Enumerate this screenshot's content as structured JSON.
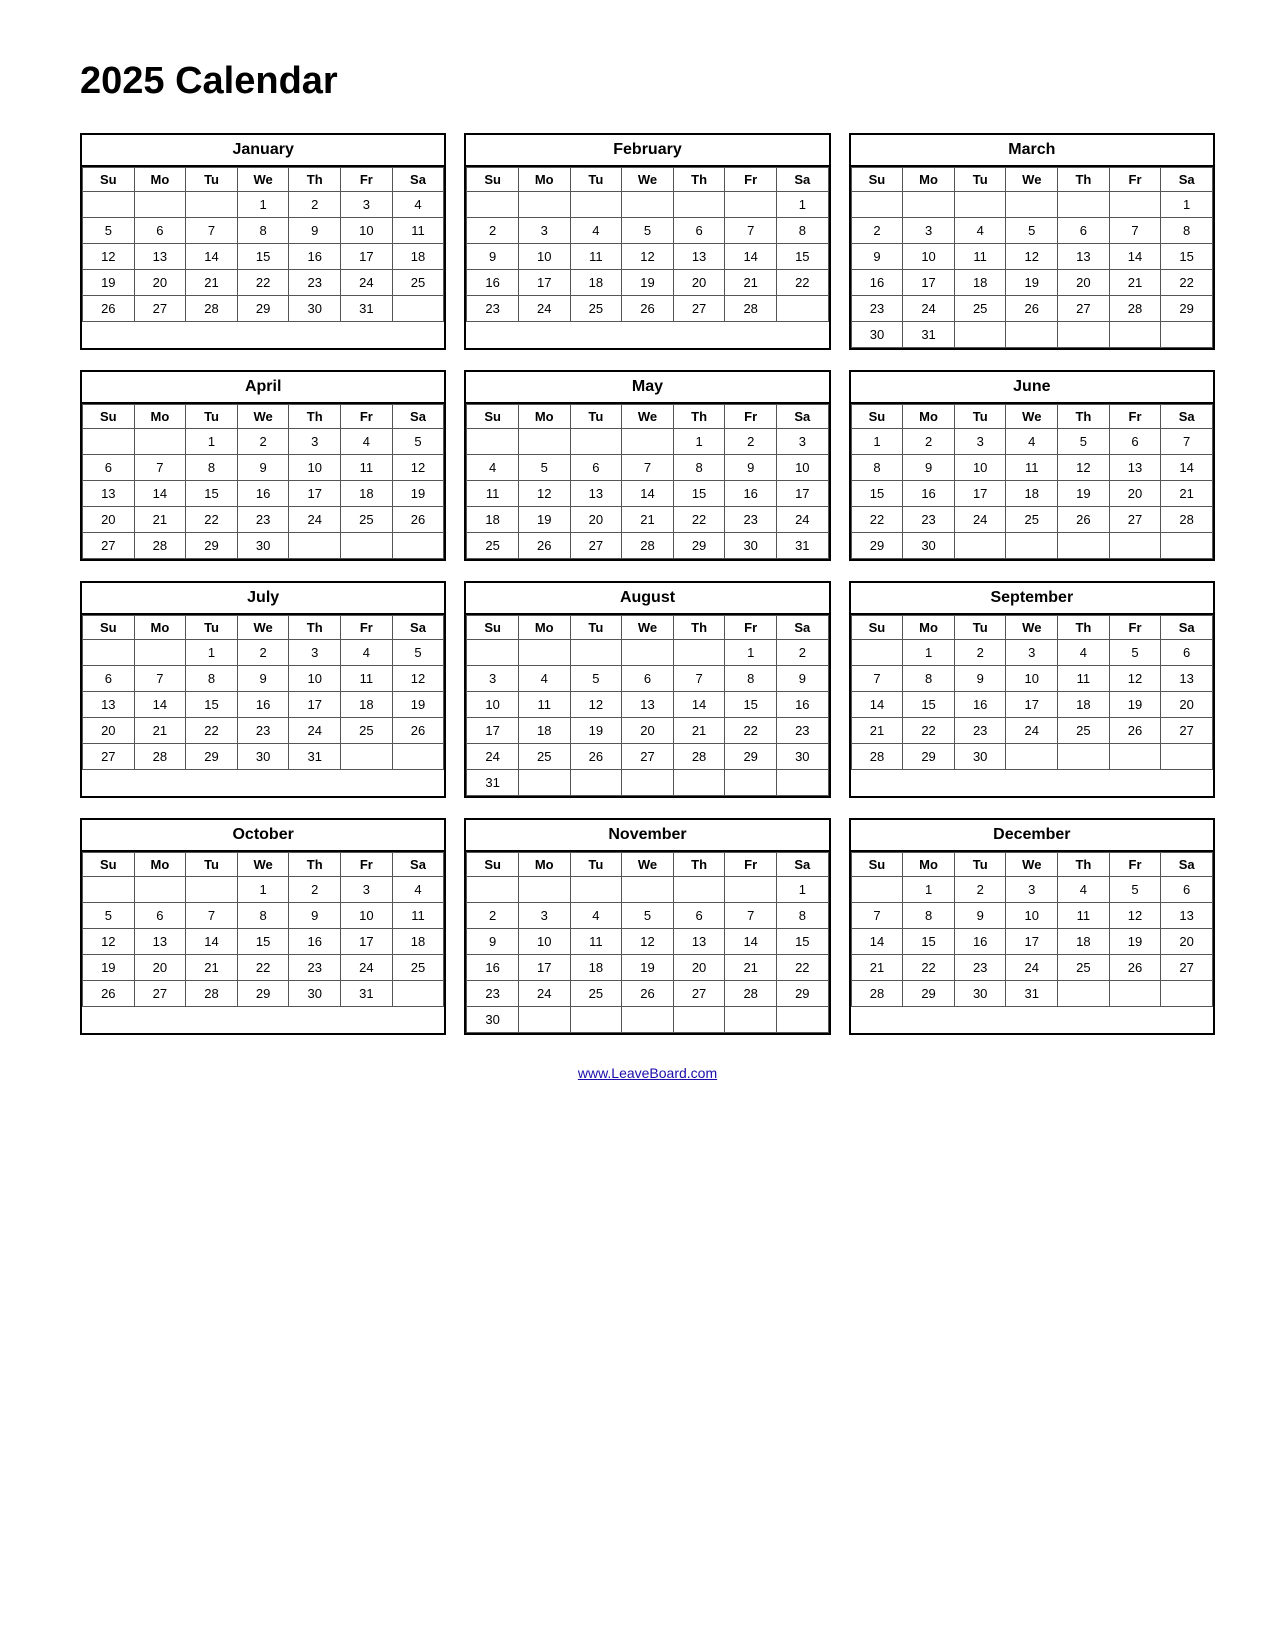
{
  "title": "2025 Calendar",
  "footer_link": "www.LeaveBoard.com",
  "days_header": [
    "Su",
    "Mo",
    "Tu",
    "We",
    "Th",
    "Fr",
    "Sa"
  ],
  "months": [
    {
      "name": "January",
      "weeks": [
        [
          "",
          "",
          "",
          "1",
          "2",
          "3",
          "4"
        ],
        [
          "5",
          "6",
          "7",
          "8",
          "9",
          "10",
          "11"
        ],
        [
          "12",
          "13",
          "14",
          "15",
          "16",
          "17",
          "18"
        ],
        [
          "19",
          "20",
          "21",
          "22",
          "23",
          "24",
          "25"
        ],
        [
          "26",
          "27",
          "28",
          "29",
          "30",
          "31",
          ""
        ]
      ]
    },
    {
      "name": "February",
      "weeks": [
        [
          "",
          "",
          "",
          "",
          "",
          "",
          "1"
        ],
        [
          "2",
          "3",
          "4",
          "5",
          "6",
          "7",
          "8"
        ],
        [
          "9",
          "10",
          "11",
          "12",
          "13",
          "14",
          "15"
        ],
        [
          "16",
          "17",
          "18",
          "19",
          "20",
          "21",
          "22"
        ],
        [
          "23",
          "24",
          "25",
          "26",
          "27",
          "28",
          ""
        ]
      ]
    },
    {
      "name": "March",
      "weeks": [
        [
          "",
          "",
          "",
          "",
          "",
          "",
          "1"
        ],
        [
          "2",
          "3",
          "4",
          "5",
          "6",
          "7",
          "8"
        ],
        [
          "9",
          "10",
          "11",
          "12",
          "13",
          "14",
          "15"
        ],
        [
          "16",
          "17",
          "18",
          "19",
          "20",
          "21",
          "22"
        ],
        [
          "23",
          "24",
          "25",
          "26",
          "27",
          "28",
          "29"
        ],
        [
          "30",
          "31",
          "",
          "",
          "",
          "",
          ""
        ]
      ]
    },
    {
      "name": "April",
      "weeks": [
        [
          "",
          "",
          "1",
          "2",
          "3",
          "4",
          "5"
        ],
        [
          "6",
          "7",
          "8",
          "9",
          "10",
          "11",
          "12"
        ],
        [
          "13",
          "14",
          "15",
          "16",
          "17",
          "18",
          "19"
        ],
        [
          "20",
          "21",
          "22",
          "23",
          "24",
          "25",
          "26"
        ],
        [
          "27",
          "28",
          "29",
          "30",
          "",
          "",
          ""
        ]
      ]
    },
    {
      "name": "May",
      "weeks": [
        [
          "",
          "",
          "",
          "",
          "1",
          "2",
          "3"
        ],
        [
          "4",
          "5",
          "6",
          "7",
          "8",
          "9",
          "10"
        ],
        [
          "11",
          "12",
          "13",
          "14",
          "15",
          "16",
          "17"
        ],
        [
          "18",
          "19",
          "20",
          "21",
          "22",
          "23",
          "24"
        ],
        [
          "25",
          "26",
          "27",
          "28",
          "29",
          "30",
          "31"
        ]
      ]
    },
    {
      "name": "June",
      "weeks": [
        [
          "1",
          "2",
          "3",
          "4",
          "5",
          "6",
          "7"
        ],
        [
          "8",
          "9",
          "10",
          "11",
          "12",
          "13",
          "14"
        ],
        [
          "15",
          "16",
          "17",
          "18",
          "19",
          "20",
          "21"
        ],
        [
          "22",
          "23",
          "24",
          "25",
          "26",
          "27",
          "28"
        ],
        [
          "29",
          "30",
          "",
          "",
          "",
          "",
          ""
        ]
      ]
    },
    {
      "name": "July",
      "weeks": [
        [
          "",
          "",
          "1",
          "2",
          "3",
          "4",
          "5"
        ],
        [
          "6",
          "7",
          "8",
          "9",
          "10",
          "11",
          "12"
        ],
        [
          "13",
          "14",
          "15",
          "16",
          "17",
          "18",
          "19"
        ],
        [
          "20",
          "21",
          "22",
          "23",
          "24",
          "25",
          "26"
        ],
        [
          "27",
          "28",
          "29",
          "30",
          "31",
          "",
          ""
        ]
      ]
    },
    {
      "name": "August",
      "weeks": [
        [
          "",
          "",
          "",
          "",
          "",
          "1",
          "2"
        ],
        [
          "3",
          "4",
          "5",
          "6",
          "7",
          "8",
          "9"
        ],
        [
          "10",
          "11",
          "12",
          "13",
          "14",
          "15",
          "16"
        ],
        [
          "17",
          "18",
          "19",
          "20",
          "21",
          "22",
          "23"
        ],
        [
          "24",
          "25",
          "26",
          "27",
          "28",
          "29",
          "30"
        ],
        [
          "31",
          "",
          "",
          "",
          "",
          "",
          ""
        ]
      ]
    },
    {
      "name": "September",
      "weeks": [
        [
          "",
          "1",
          "2",
          "3",
          "4",
          "5",
          "6"
        ],
        [
          "7",
          "8",
          "9",
          "10",
          "11",
          "12",
          "13"
        ],
        [
          "14",
          "15",
          "16",
          "17",
          "18",
          "19",
          "20"
        ],
        [
          "21",
          "22",
          "23",
          "24",
          "25",
          "26",
          "27"
        ],
        [
          "28",
          "29",
          "30",
          "",
          "",
          "",
          ""
        ]
      ]
    },
    {
      "name": "October",
      "weeks": [
        [
          "",
          "",
          "",
          "1",
          "2",
          "3",
          "4"
        ],
        [
          "5",
          "6",
          "7",
          "8",
          "9",
          "10",
          "11"
        ],
        [
          "12",
          "13",
          "14",
          "15",
          "16",
          "17",
          "18"
        ],
        [
          "19",
          "20",
          "21",
          "22",
          "23",
          "24",
          "25"
        ],
        [
          "26",
          "27",
          "28",
          "29",
          "30",
          "31",
          ""
        ]
      ]
    },
    {
      "name": "November",
      "weeks": [
        [
          "",
          "",
          "",
          "",
          "",
          "",
          "1"
        ],
        [
          "2",
          "3",
          "4",
          "5",
          "6",
          "7",
          "8"
        ],
        [
          "9",
          "10",
          "11",
          "12",
          "13",
          "14",
          "15"
        ],
        [
          "16",
          "17",
          "18",
          "19",
          "20",
          "21",
          "22"
        ],
        [
          "23",
          "24",
          "25",
          "26",
          "27",
          "28",
          "29"
        ],
        [
          "30",
          "",
          "",
          "",
          "",
          "",
          ""
        ]
      ]
    },
    {
      "name": "December",
      "weeks": [
        [
          "",
          "1",
          "2",
          "3",
          "4",
          "5",
          "6"
        ],
        [
          "7",
          "8",
          "9",
          "10",
          "11",
          "12",
          "13"
        ],
        [
          "14",
          "15",
          "16",
          "17",
          "18",
          "19",
          "20"
        ],
        [
          "21",
          "22",
          "23",
          "24",
          "25",
          "26",
          "27"
        ],
        [
          "28",
          "29",
          "30",
          "31",
          "",
          "",
          ""
        ]
      ]
    }
  ]
}
